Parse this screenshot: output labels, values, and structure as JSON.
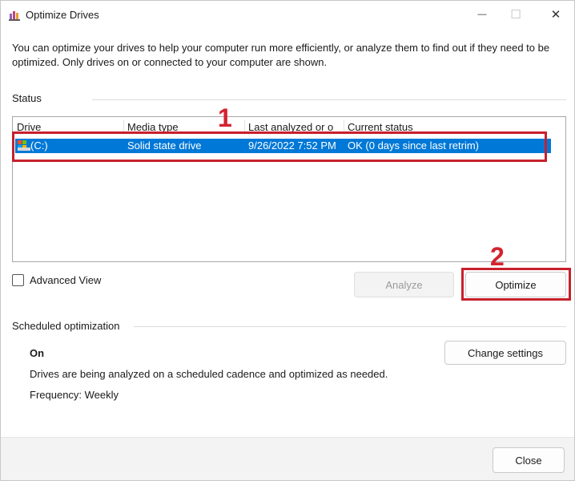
{
  "window": {
    "title": "Optimize Drives",
    "icon": "optimize-drives-app-icon",
    "controls": {
      "minimize_glyph": "—",
      "maximize_glyph": "☐",
      "close_glyph": "✕"
    }
  },
  "intro": "You can optimize your drives to help your computer run more efficiently, or analyze them to find out if they need to be optimized. Only drives on or connected to your computer are shown.",
  "status": {
    "label": "Status",
    "columns": [
      "Drive",
      "Media type",
      "Last analyzed or o",
      "Current status"
    ],
    "drives": [
      {
        "icon": "drive-icon",
        "drive": "(C:)",
        "media_type": "Solid state drive",
        "last_analyzed": "9/26/2022 7:52 PM",
        "current_status": "OK (0 days since last retrim)",
        "selected": true
      }
    ]
  },
  "annotations": {
    "step1": "1",
    "step2": "2",
    "color": "#d3232f"
  },
  "advanced_view": {
    "label": "Advanced View",
    "checked": false
  },
  "buttons": {
    "analyze": "Analyze",
    "optimize": "Optimize",
    "change_settings": "Change settings",
    "close": "Close"
  },
  "scheduled": {
    "label": "Scheduled optimization",
    "state": "On",
    "description": "Drives are being analyzed on a scheduled cadence and optimized as needed.",
    "frequency": "Frequency: Weekly"
  },
  "colors": {
    "selection": "#0078d7",
    "highlight_box": "#c8202c"
  }
}
